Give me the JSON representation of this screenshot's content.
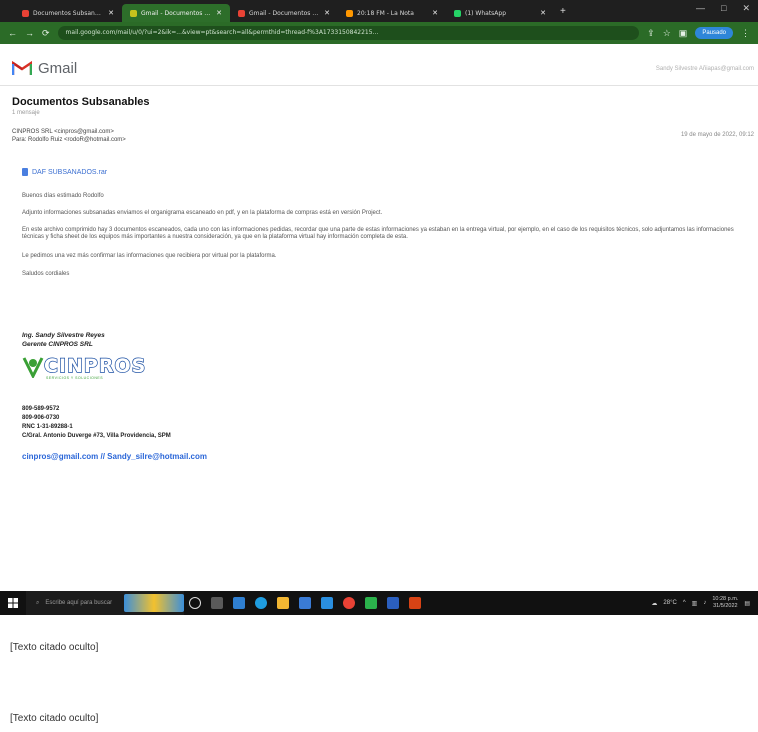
{
  "browser": {
    "tabs": [
      {
        "title": "Documentos Subsanable",
        "active": false
      },
      {
        "title": "Gmail - Documentos Sub",
        "active": true
      },
      {
        "title": "Gmail - Documentos Sub",
        "active": false
      },
      {
        "title": "20:18 FM - La Nota",
        "active": false
      },
      {
        "title": "(1) WhatsApp",
        "active": false
      }
    ],
    "url": "mail.google.com/mail/u/0/?ui=2&ik=...&view=pt&search=all&permthid=thread-f%3A1733150842215...",
    "pill_label": "Pausado"
  },
  "gmail": {
    "brand": "Gmail",
    "user": "Sandy Silvestre Añiapas@gmail.com"
  },
  "email": {
    "subject": "Documentos Subsanables",
    "label": "1 mensaje",
    "from": "CINPROS SRL <cinpros@gmail.com>",
    "to": "Para: Rodolfo Ruiz <rodoR@hotmail.com>",
    "date": "19 de mayo de 2022, 09:12",
    "attachment": "DAF SUBSANADOS.rar",
    "greeting": "Buenos días estimado Rodolfo",
    "p1": "Adjunto informaciones subsanadas enviamos el organigrama escaneado en pdf, y en la plataforma de compras está en versión Project.",
    "p2": "En este archivo comprimido hay 3 documentos escaneados, cada uno con las informaciones pedidas, recordar que una parte de estas informaciones ya estaban en la entrega virtual, por ejemplo, en el caso de los requisitos técnicos, solo adjuntamos las informaciones técnicas y ficha sheet de los equipos más importantes a nuestra consideración, ya que en la plataforma virtual hay información completa de esta.",
    "p3": "Le pedimos una vez más confirmar las informaciones que recibiera por virtual por la plataforma.",
    "closing": "Saludos cordiales",
    "signature": {
      "name": "Ing. Sandy Silvestre Reyes",
      "role": "Gerente CINPROS SRL",
      "logo_text": "CINPROS",
      "logo_tagline": "SERVICIOS Y SOLUCIONES",
      "phone1": "809-589-9572",
      "phone2": "809-906-0730",
      "rnc": "RNC 1-31-89288-1",
      "address": "C/Gral. Antonio Duverge #73, Villa Providencia, SPM",
      "links": "cinpros@gmail.com // Sandy_silre@hotmail.com"
    }
  },
  "taskbar": {
    "search_placeholder": "Escribe aquí para buscar",
    "weather": "28°C",
    "time": "10:28 p.m.",
    "date": "31/5/2022"
  },
  "quoted": [
    "[Texto citado oculto]",
    "[Texto citado oculto]"
  ]
}
